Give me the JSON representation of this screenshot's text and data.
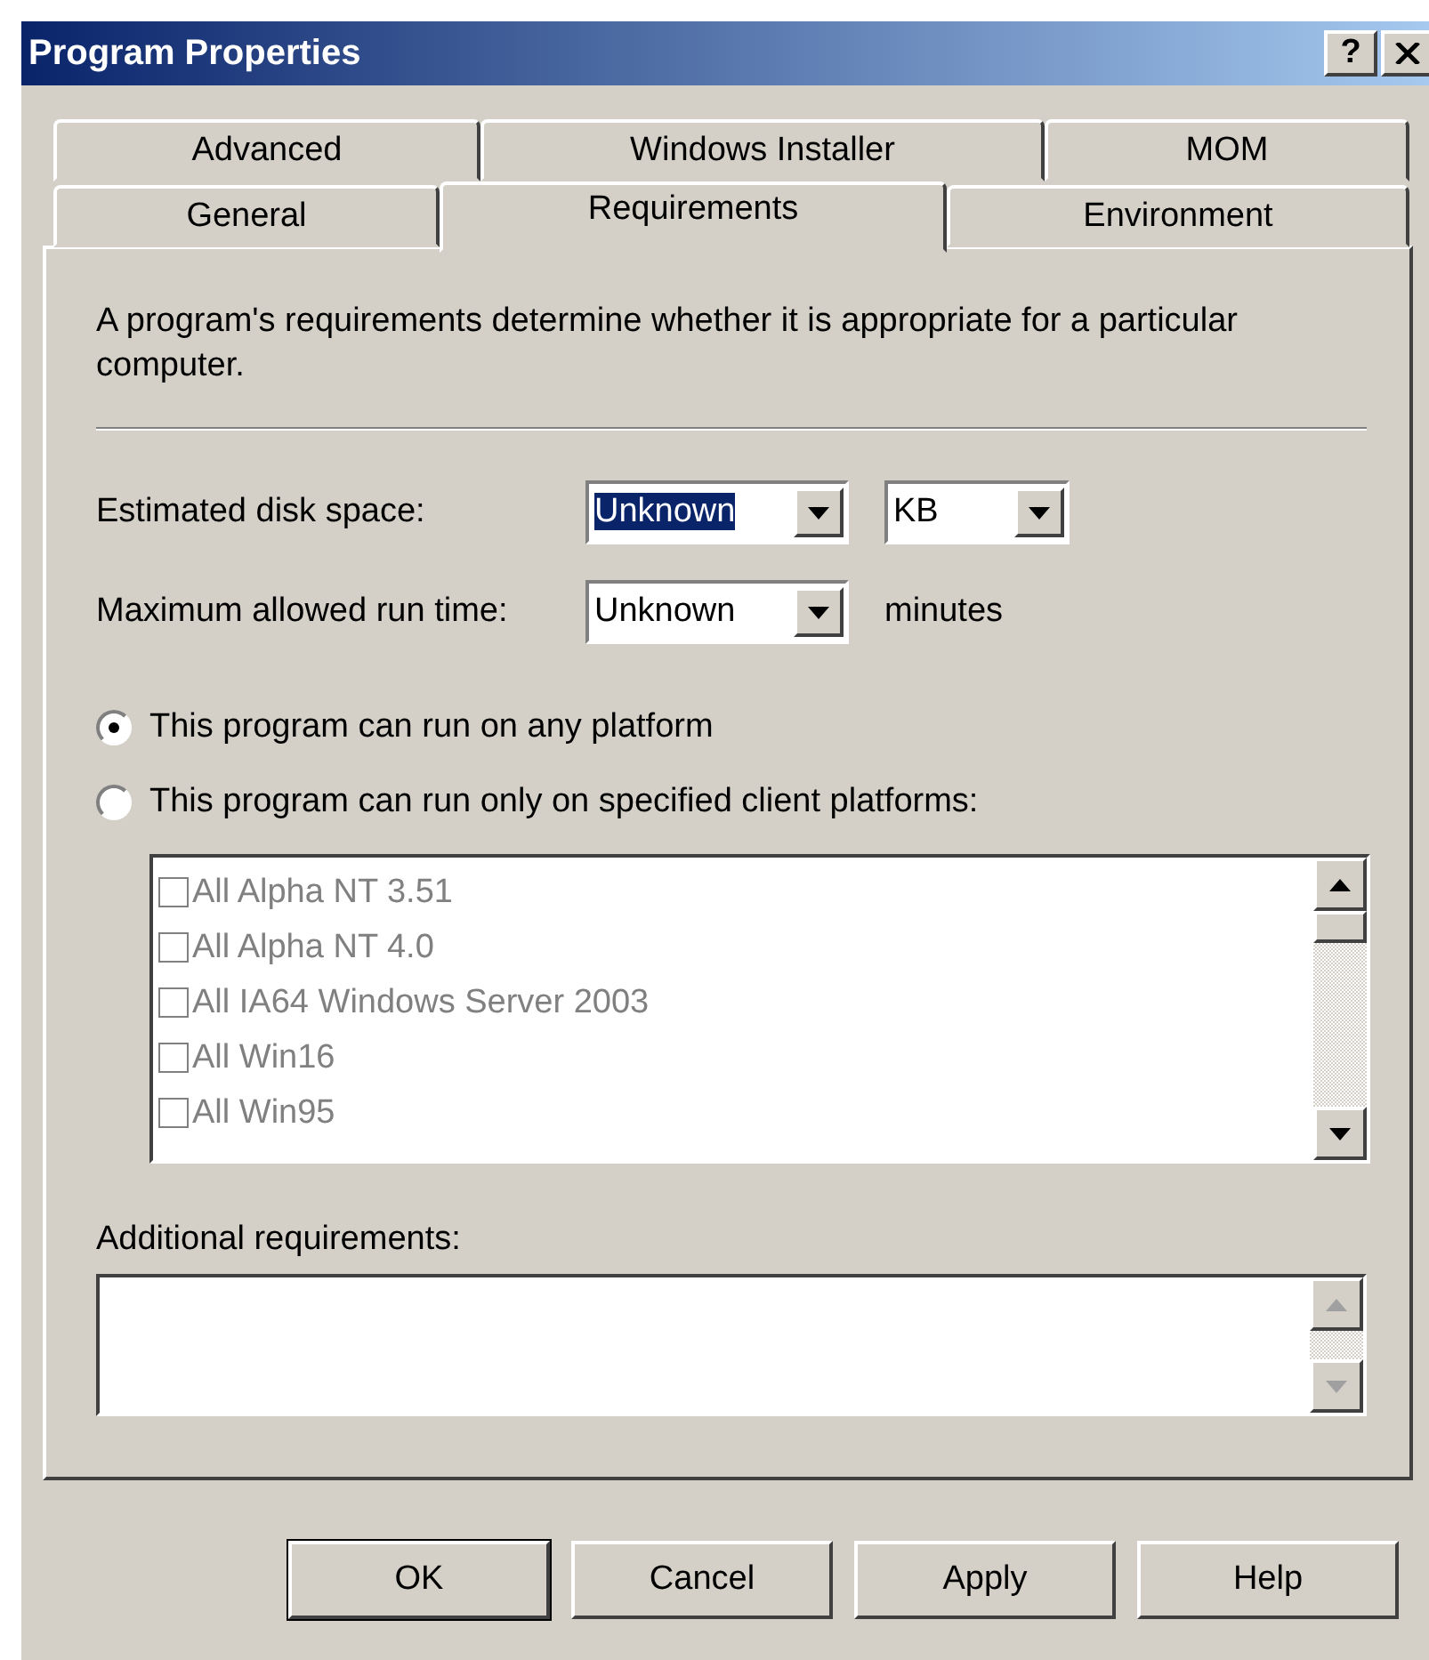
{
  "window": {
    "title": "Program Properties",
    "help_button": "?"
  },
  "tab_rows": [
    [
      {
        "label": "Advanced",
        "selected": false
      },
      {
        "label": "Windows Installer",
        "selected": false
      },
      {
        "label": "MOM",
        "selected": false
      }
    ],
    [
      {
        "label": "General",
        "selected": false
      },
      {
        "label": "Requirements",
        "selected": true
      },
      {
        "label": "Environment",
        "selected": false
      }
    ]
  ],
  "description": "A program's requirements determine whether it is appropriate for a particular computer.",
  "disk_space": {
    "label": "Estimated disk space:",
    "value": "Unknown",
    "highlighted": true,
    "unit": "KB"
  },
  "run_time": {
    "label": "Maximum allowed run time:",
    "value": "Unknown",
    "highlighted": false,
    "suffix": "minutes"
  },
  "platform_options": [
    {
      "label": "This program can run on any platform",
      "selected": true
    },
    {
      "label": "This program can run only on specified client platforms:",
      "selected": false
    }
  ],
  "platforms": {
    "disabled": true,
    "items": [
      {
        "label": "All Alpha NT 3.51",
        "checked": false
      },
      {
        "label": "All Alpha NT 4.0",
        "checked": false
      },
      {
        "label": "All IA64 Windows Server 2003",
        "checked": false
      },
      {
        "label": "All Win16",
        "checked": false
      },
      {
        "label": "All Win95",
        "checked": false
      }
    ]
  },
  "additional": {
    "label": "Additional requirements:"
  },
  "buttons": [
    {
      "label": "OK",
      "default": true
    },
    {
      "label": "Cancel",
      "default": false
    },
    {
      "label": "Apply",
      "default": false
    },
    {
      "label": "Help",
      "default": false
    }
  ]
}
